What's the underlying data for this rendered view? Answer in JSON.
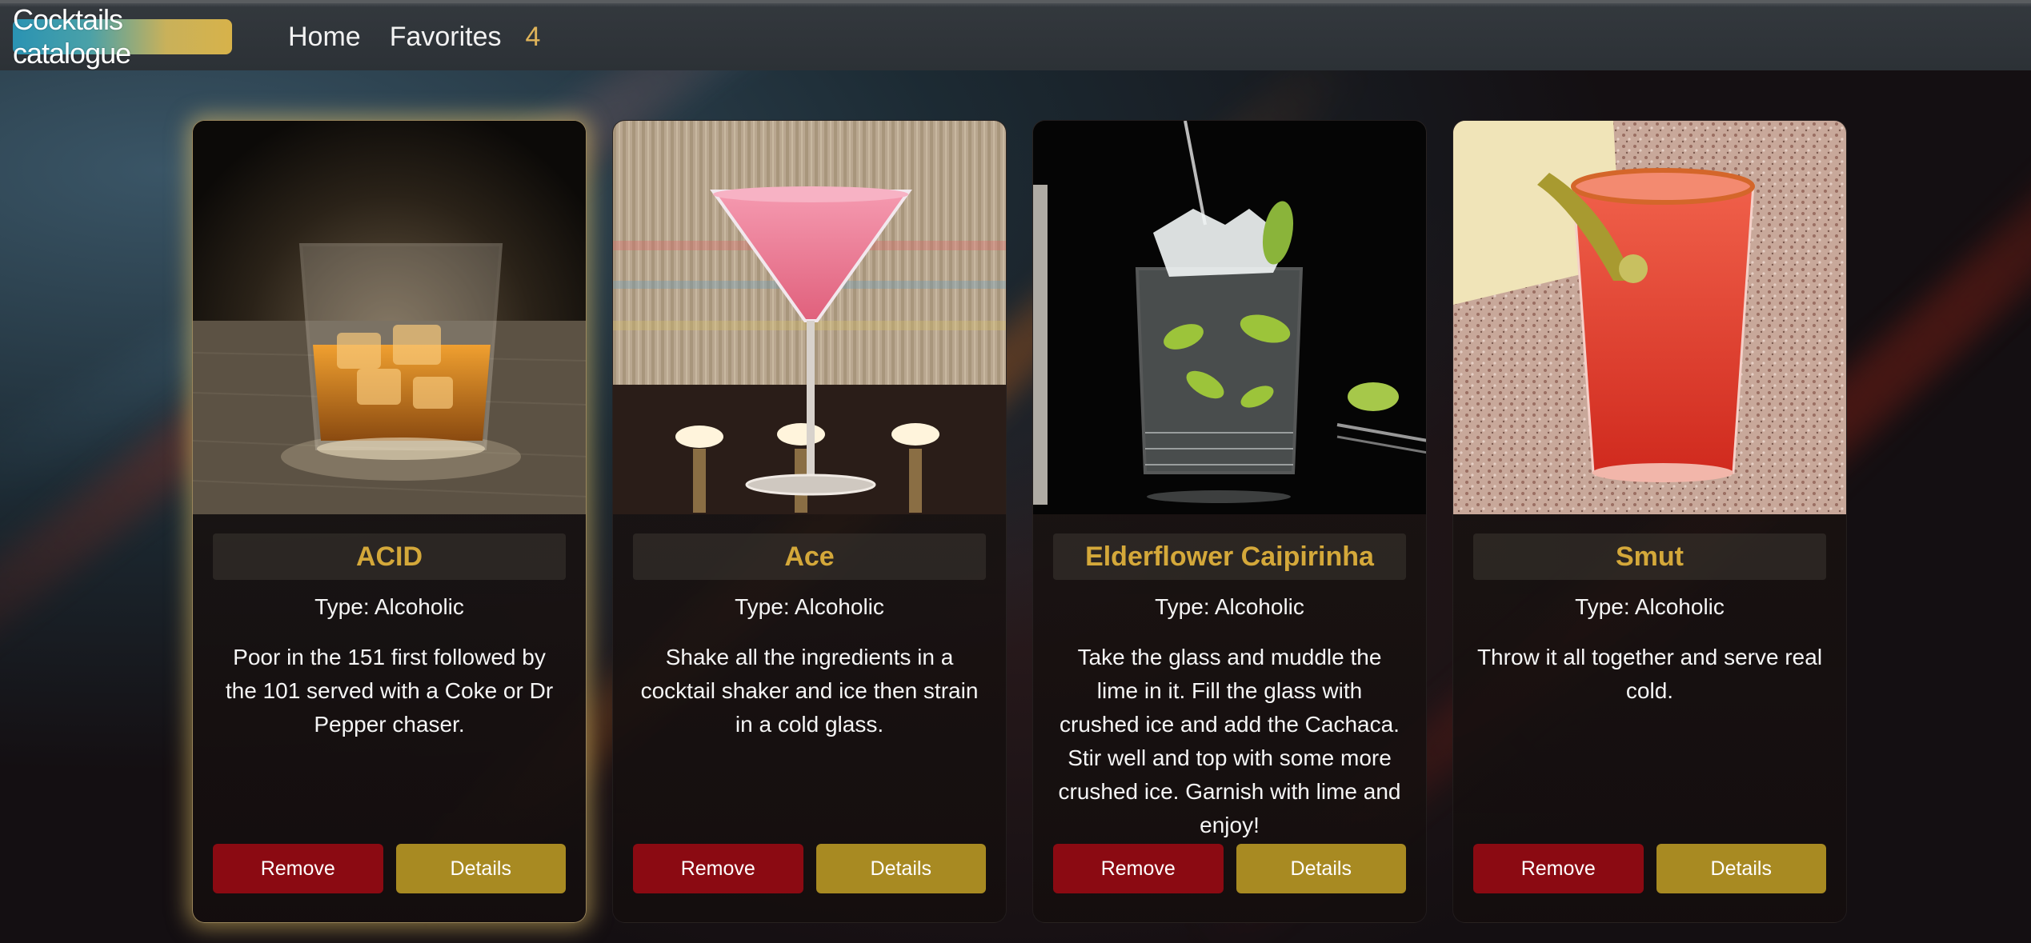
{
  "nav": {
    "brand": "Cocktails catalogue",
    "home": "Home",
    "favorites": "Favorites",
    "favorites_count": "4"
  },
  "cards": [
    {
      "title": "ACID",
      "type": "Type: Alcoholic",
      "description": "Poor in the 151 first followed by the 101 served with a Coke or Dr Pepper chaser.",
      "remove_label": "Remove",
      "details_label": "Details",
      "image_icon": "whiskey-glass-photo"
    },
    {
      "title": "Ace",
      "type": "Type: Alcoholic",
      "description": "Shake all the ingredients in a cocktail shaker and ice then strain in a cold glass.",
      "remove_label": "Remove",
      "details_label": "Details",
      "image_icon": "martini-glass-photo"
    },
    {
      "title": "Elderflower Caipirinha",
      "type": "Type: Alcoholic",
      "description": "Take the glass and muddle the lime in it. Fill the glass with crushed ice and add the Cachaca. Stir well and top with some more crushed ice. Garnish with lime and enjoy!",
      "remove_label": "Remove",
      "details_label": "Details",
      "image_icon": "caipirinha-glass-photo"
    },
    {
      "title": "Smut",
      "type": "Type: Alcoholic",
      "description": "Throw it all together and serve real cold.",
      "remove_label": "Remove",
      "details_label": "Details",
      "image_icon": "red-cocktail-photo"
    }
  ],
  "colors": {
    "title_gold": "#d4a83a",
    "remove_red": "#8b0a12",
    "details_gold": "#a88a22",
    "favorites_count": "#e0b45a"
  }
}
